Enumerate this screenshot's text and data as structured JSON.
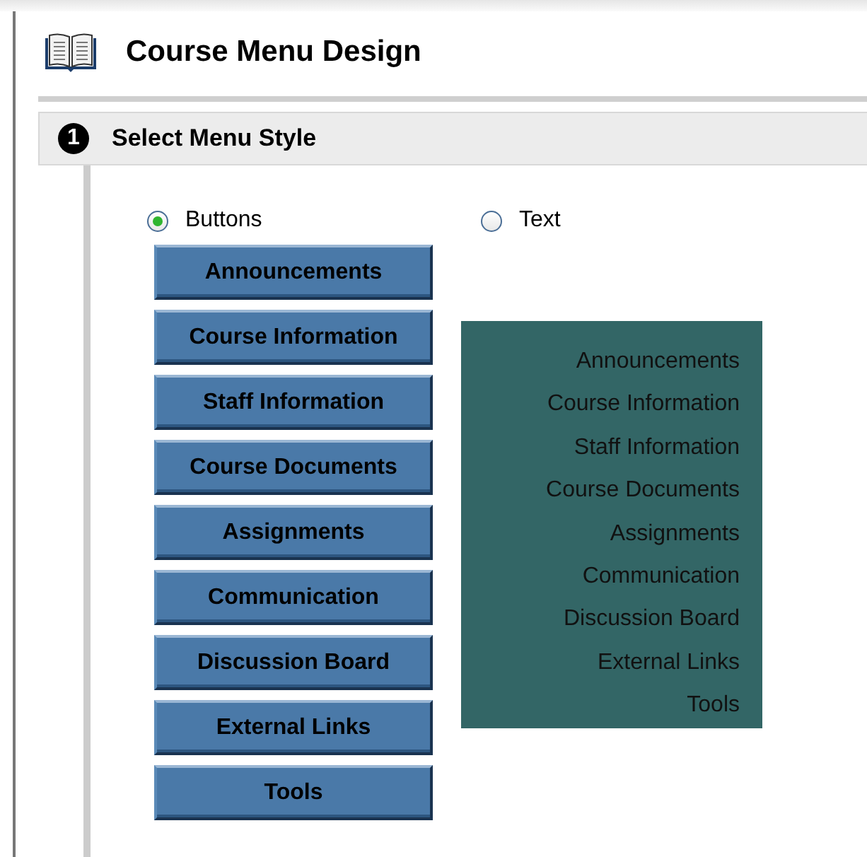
{
  "title": "Course Menu Design",
  "step": {
    "number": "1",
    "title": "Select Menu Style"
  },
  "styles": [
    {
      "label": "Buttons",
      "selected": true
    },
    {
      "label": "Text",
      "selected": false
    }
  ],
  "button_preview": [
    "Announcements",
    "Course Information",
    "Staff Information",
    "Course Documents",
    "Assignments",
    "Communication",
    "Discussion Board",
    "External Links",
    "Tools"
  ],
  "text_preview": [
    "Announcements",
    "Course Information",
    "Staff Information",
    "Course Documents",
    "Assignments",
    "Communication",
    "Discussion Board",
    "External Links",
    "Tools"
  ]
}
